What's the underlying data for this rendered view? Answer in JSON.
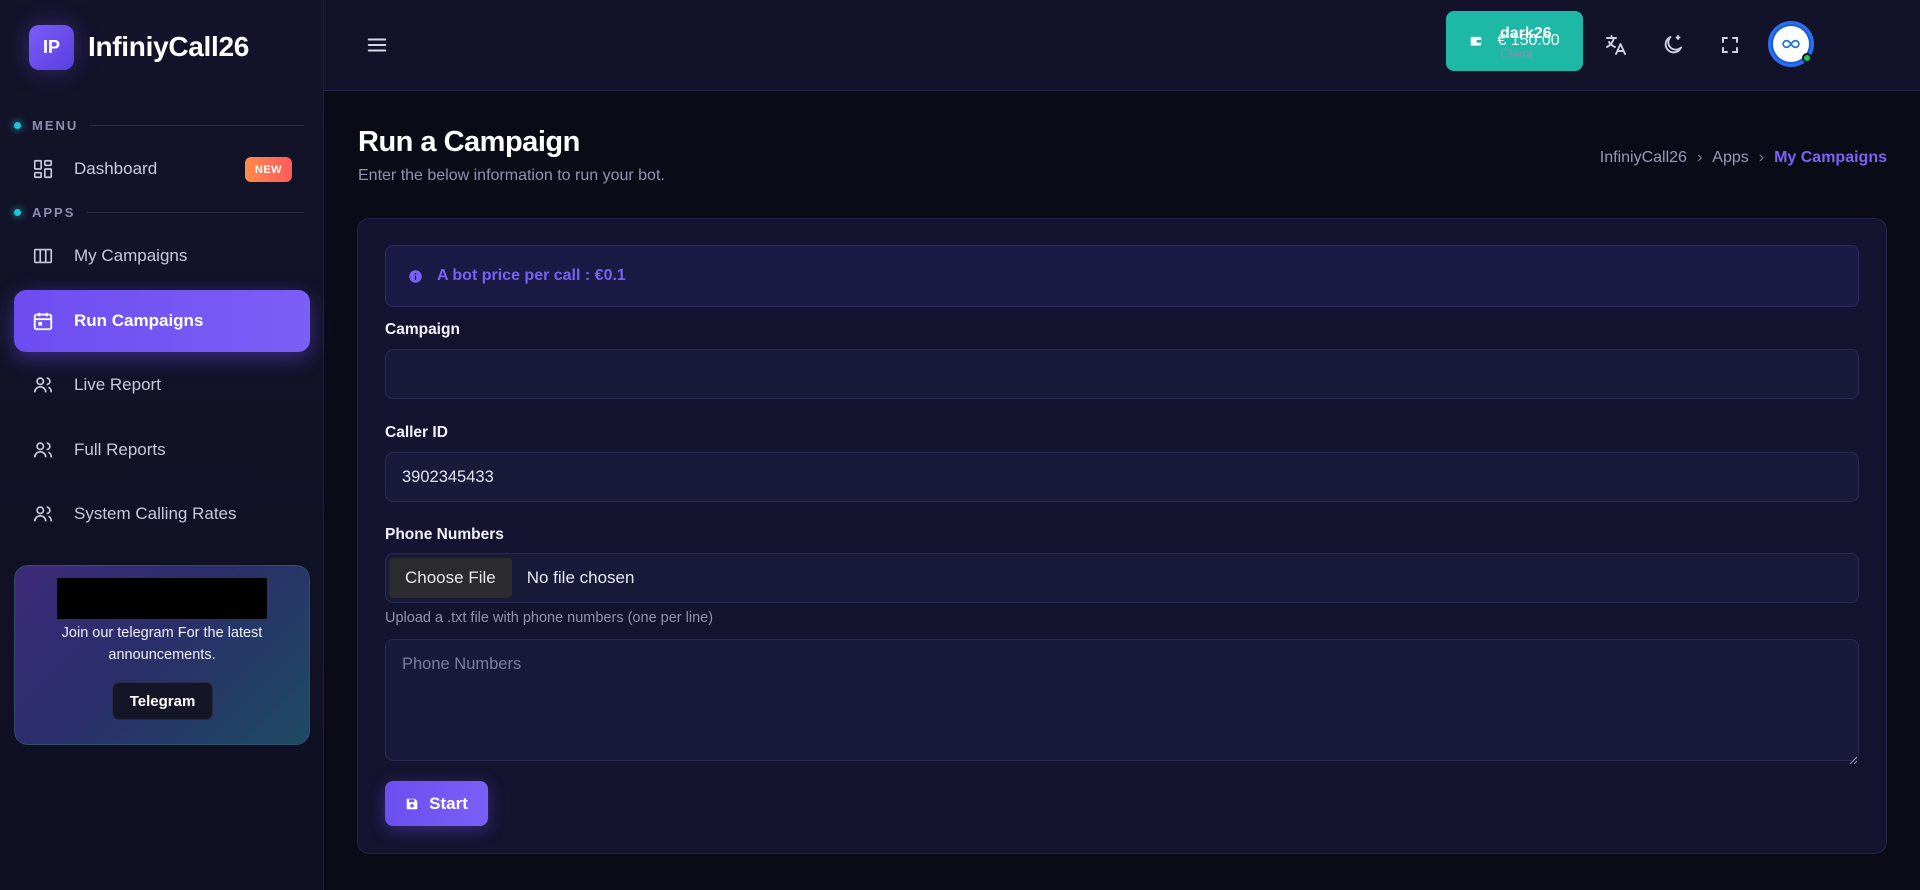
{
  "app": {
    "logo_text": "IP",
    "name": "InfiniyCall26"
  },
  "sidebar": {
    "section_menu": "MENU",
    "section_apps": "APPS",
    "items": [
      {
        "label": "Dashboard",
        "icon": "dashboard-icon",
        "badge": "NEW"
      },
      {
        "label": "My Campaigns",
        "icon": "columns-icon"
      },
      {
        "label": "Run Campaigns",
        "icon": "calendar-icon",
        "active": true
      },
      {
        "label": "Live Report",
        "icon": "users-icon"
      },
      {
        "label": "Full Reports",
        "icon": "users-icon"
      },
      {
        "label": "System Calling Rates",
        "icon": "users-icon"
      }
    ],
    "promo": {
      "text": "Join our telegram For the latest announcements.",
      "button": "Telegram"
    }
  },
  "topbar": {
    "wallet_amount": "€ 150.00",
    "user": {
      "name": "dark26",
      "role": "Client"
    }
  },
  "page": {
    "title": "Run a Campaign",
    "subtitle": "Enter the below information to run your bot.",
    "breadcrumb": [
      "InfiniyCall26",
      "Apps",
      "My Campaigns"
    ]
  },
  "form": {
    "alert": "A bot price per call : €0.1",
    "campaign_label": "Campaign",
    "campaign_value": "",
    "caller_id_label": "Caller ID",
    "caller_id_value": "3902345433",
    "phone_numbers_label": "Phone Numbers",
    "file_button": "Choose File",
    "file_status": "No file chosen",
    "help_text": "Upload a .txt file with phone numbers (one per line)",
    "phone_numbers_placeholder": "Phone Numbers",
    "start_button": "Start"
  },
  "colors": {
    "accent": "#7a5ff7",
    "wallet": "#1db8a6",
    "badge": "#ff6a52",
    "status_online": "#22c55e"
  }
}
